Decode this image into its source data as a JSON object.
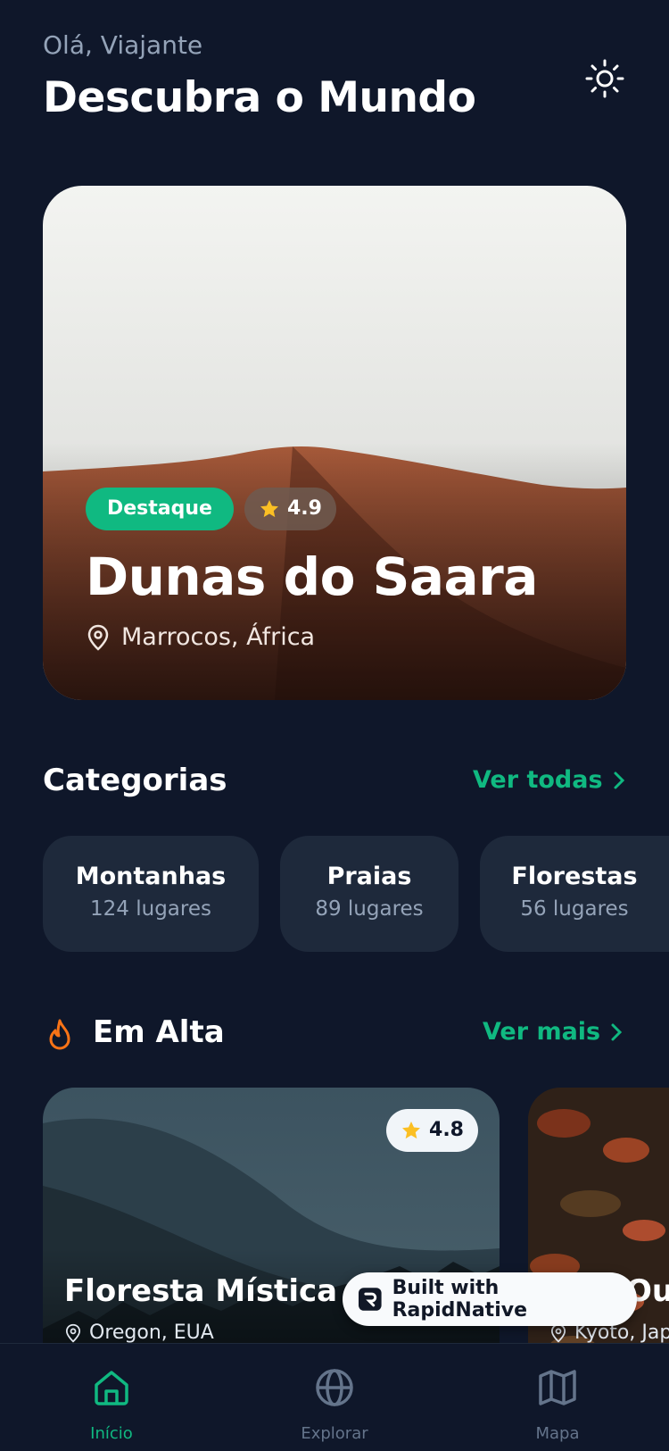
{
  "header": {
    "greeting": "Olá, Viajante",
    "title": "Descubra o Mundo"
  },
  "theme_toggle": {
    "icon": "sun-icon"
  },
  "featured": {
    "badge": "Destaque",
    "rating": "4.9",
    "title": "Dunas do Saara",
    "location": "Marrocos, África"
  },
  "categories": {
    "title": "Categorias",
    "see_all": "Ver todas",
    "items": [
      {
        "name": "Montanhas",
        "count": "124 lugares"
      },
      {
        "name": "Praias",
        "count": "89 lugares"
      },
      {
        "name": "Florestas",
        "count": "56 lugares"
      }
    ]
  },
  "trending": {
    "title": "Em Alta",
    "see_more": "Ver mais",
    "items": [
      {
        "title": "Floresta Mística",
        "location": "Oregon, EUA",
        "rating": "4.8"
      },
      {
        "title": "Outono",
        "location": "Kyoto, Japão",
        "rating": ""
      }
    ]
  },
  "built_with": "Built with RapidNative",
  "tabs": [
    {
      "label": "Início",
      "icon": "home-icon",
      "active": true
    },
    {
      "label": "Explorar",
      "icon": "globe-icon",
      "active": false
    },
    {
      "label": "Mapa",
      "icon": "map-icon",
      "active": false
    }
  ],
  "colors": {
    "accent": "#10b981",
    "background": "#0f172a",
    "card": "#1e293b",
    "star": "#fbbf24"
  }
}
